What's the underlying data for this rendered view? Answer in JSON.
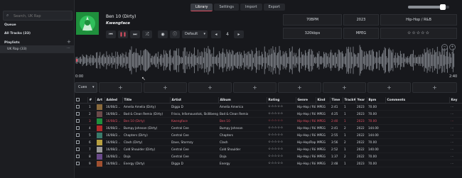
{
  "nav": {
    "tabs": [
      "Library",
      "Settings",
      "Import",
      "Export"
    ],
    "active": 0
  },
  "window": {
    "volume": 0.85
  },
  "sidebar": {
    "search_placeholder": "Search, UK Rap",
    "queue_label": "Queue",
    "all_tracks_label": "All Tracks (33)",
    "playlists_label": "Playlists",
    "playlist_items": [
      "UK Rap (33)"
    ]
  },
  "player": {
    "title": "Ben 10 (Dirty)",
    "artist": "Kwengface",
    "preset": "Default",
    "counter": "4",
    "position": "0:00",
    "duration": "2:40",
    "progress": 0.0
  },
  "info": {
    "bpm": "70BPM",
    "year": "2023",
    "genre": "Hip-Hop / R&B",
    "bitrate": "320kbps",
    "kind": "MPEG",
    "rating": "☆☆☆☆☆"
  },
  "cues": {
    "label": "Cues",
    "add": "+"
  },
  "table": {
    "columns": [
      "#",
      "Art",
      "Added",
      "Title",
      "Artist",
      "Album",
      "Rating",
      "Genre",
      "Kind",
      "Time",
      "Track#",
      "Year",
      "Bpm",
      "Comments",
      "Key"
    ],
    "rows": [
      {
        "n": "1",
        "added": "16/08/2…",
        "title": "Amelia Amelia (Dirty)",
        "artist": "Digga D",
        "album": "Amelia America",
        "rating": "☆☆☆☆☆",
        "genre": "Hip-Hop / R&B",
        "kind": "MPEG",
        "time": "2:41",
        "track": "1",
        "year": "2023",
        "bpm": "70.00",
        "art": "#8a6a3c"
      },
      {
        "n": "2",
        "added": "16/08/2…",
        "title": "Bad & Clean Remix (Dirty)",
        "artist": "Frisco, Infamousstok, Skillibeng, D…",
        "album": "Bad & Clean Remix",
        "rating": "☆☆☆☆☆",
        "genre": "Hip-Hop / R&B",
        "kind": "MPEG",
        "time": "4:25",
        "track": "1",
        "year": "2023",
        "bpm": "70.00",
        "art": "#6b4a4a"
      },
      {
        "n": "3",
        "added": "16/08/2…",
        "title": "Ben 10 (Dirty)",
        "artist": "Kwengface",
        "album": "Ben 10",
        "rating": "☆☆☆☆☆",
        "genre": "Hip-Hop / R&B",
        "kind": "MPEG",
        "time": "2:40",
        "track": "1",
        "year": "2023",
        "bpm": "70.00",
        "art": "#1f8f3c",
        "playing": true
      },
      {
        "n": "4",
        "added": "16/08/2…",
        "title": "Bumpy Johnson (Dirty)",
        "artist": "Central Cee",
        "album": "Bumpy Johnson",
        "rating": "☆☆☆☆☆",
        "genre": "Hip-Hop / R&B",
        "kind": "MPEG",
        "time": "2:41",
        "track": "2",
        "year": "2022",
        "bpm": "144.00",
        "art": "#b02a2a"
      },
      {
        "n": "5",
        "added": "16/08/2…",
        "title": "Chapters (Dirty)",
        "artist": "Central Cee",
        "album": "Chapters",
        "rating": "☆☆☆☆☆",
        "genre": "Hip-Hop / R&B",
        "kind": "MPEG",
        "time": "2:55",
        "track": "1",
        "year": "2022",
        "bpm": "144.00",
        "art": "#3a7a6a"
      },
      {
        "n": "6",
        "added": "16/08/2…",
        "title": "Clash (Dirty)",
        "artist": "Dave, Stormzy",
        "album": "Clash",
        "rating": "☆☆☆☆☆",
        "genre": "Hip-Hop/Rap",
        "kind": "MPEG",
        "time": "3:56",
        "track": "2",
        "year": "2022",
        "bpm": "70.00",
        "art": "#b8a040"
      },
      {
        "n": "7",
        "added": "16/08/2…",
        "title": "Cold Shoulder (Dirty)",
        "artist": "Central Cee",
        "album": "Cold Shoulder",
        "rating": "☆☆☆☆☆",
        "genre": "Hip-Hop / R&B",
        "kind": "MPEG",
        "time": "2:52",
        "track": "1",
        "year": "2022",
        "bpm": "140.00",
        "art": "#9a9a9a"
      },
      {
        "n": "8",
        "added": "16/08/2…",
        "title": "Doja",
        "artist": "Central Cee",
        "album": "Doja",
        "rating": "☆☆☆☆☆",
        "genre": "Hip-Hop / R&B",
        "kind": "MPEG",
        "time": "1:37",
        "track": "2",
        "year": "2022",
        "bpm": "70.00",
        "art": "#6a4a8a"
      },
      {
        "n": "9",
        "added": "16/08/2…",
        "title": "Energy (Dirty)",
        "artist": "Digga D",
        "album": "Energy",
        "rating": "☆☆☆☆☆",
        "genre": "Hip-Hop / R&B",
        "kind": "MPEG",
        "time": "2:48",
        "track": "1",
        "year": "2023",
        "bpm": "70.00",
        "art": "#a05030"
      }
    ]
  }
}
